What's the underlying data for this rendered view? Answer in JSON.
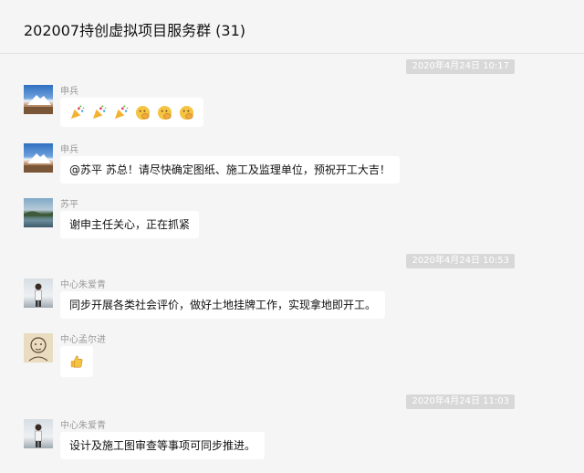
{
  "header": {
    "title": "202007持创虚拟项目服务群 (31)"
  },
  "timestamps": [
    "2020年4月24日 10:17",
    "2020年4月24日 10:53",
    "2020年4月24日 11:03"
  ],
  "messages": [
    {
      "sender": "申兵",
      "type": "emoji",
      "avatar": "mountain-avatar",
      "emojis": [
        "party-popper-icon",
        "party-popper-icon",
        "party-popper-icon",
        "fist-bump-icon",
        "fist-bump-icon",
        "fist-bump-icon"
      ]
    },
    {
      "sender": "申兵",
      "type": "text",
      "avatar": "mountain-avatar",
      "text": "@苏平 苏总！请尽快确定图纸、施工及监理单位，预祝开工大吉！"
    },
    {
      "sender": "苏平",
      "type": "text",
      "avatar": "lake-avatar",
      "text": "谢申主任关心，正在抓紧"
    },
    {
      "sender": "中心朱爱青",
      "type": "text",
      "avatar": "person-avatar",
      "text": "同步开展各类社会评价，做好土地挂牌工作，实现拿地即开工。"
    },
    {
      "sender": "中心孟尔进",
      "type": "emoji",
      "avatar": "sketch-avatar",
      "emojis": [
        "thumbs-up-icon"
      ]
    },
    {
      "sender": "中心朱爱青",
      "type": "text",
      "avatar": "person-avatar",
      "text": "设计及施工图审查等事项可同步推进。"
    }
  ],
  "colors": {
    "background": "#f5f5f5",
    "bubble": "#ffffff",
    "timestamp_bg": "#d8d8d8",
    "sender": "#9a9a9a"
  }
}
